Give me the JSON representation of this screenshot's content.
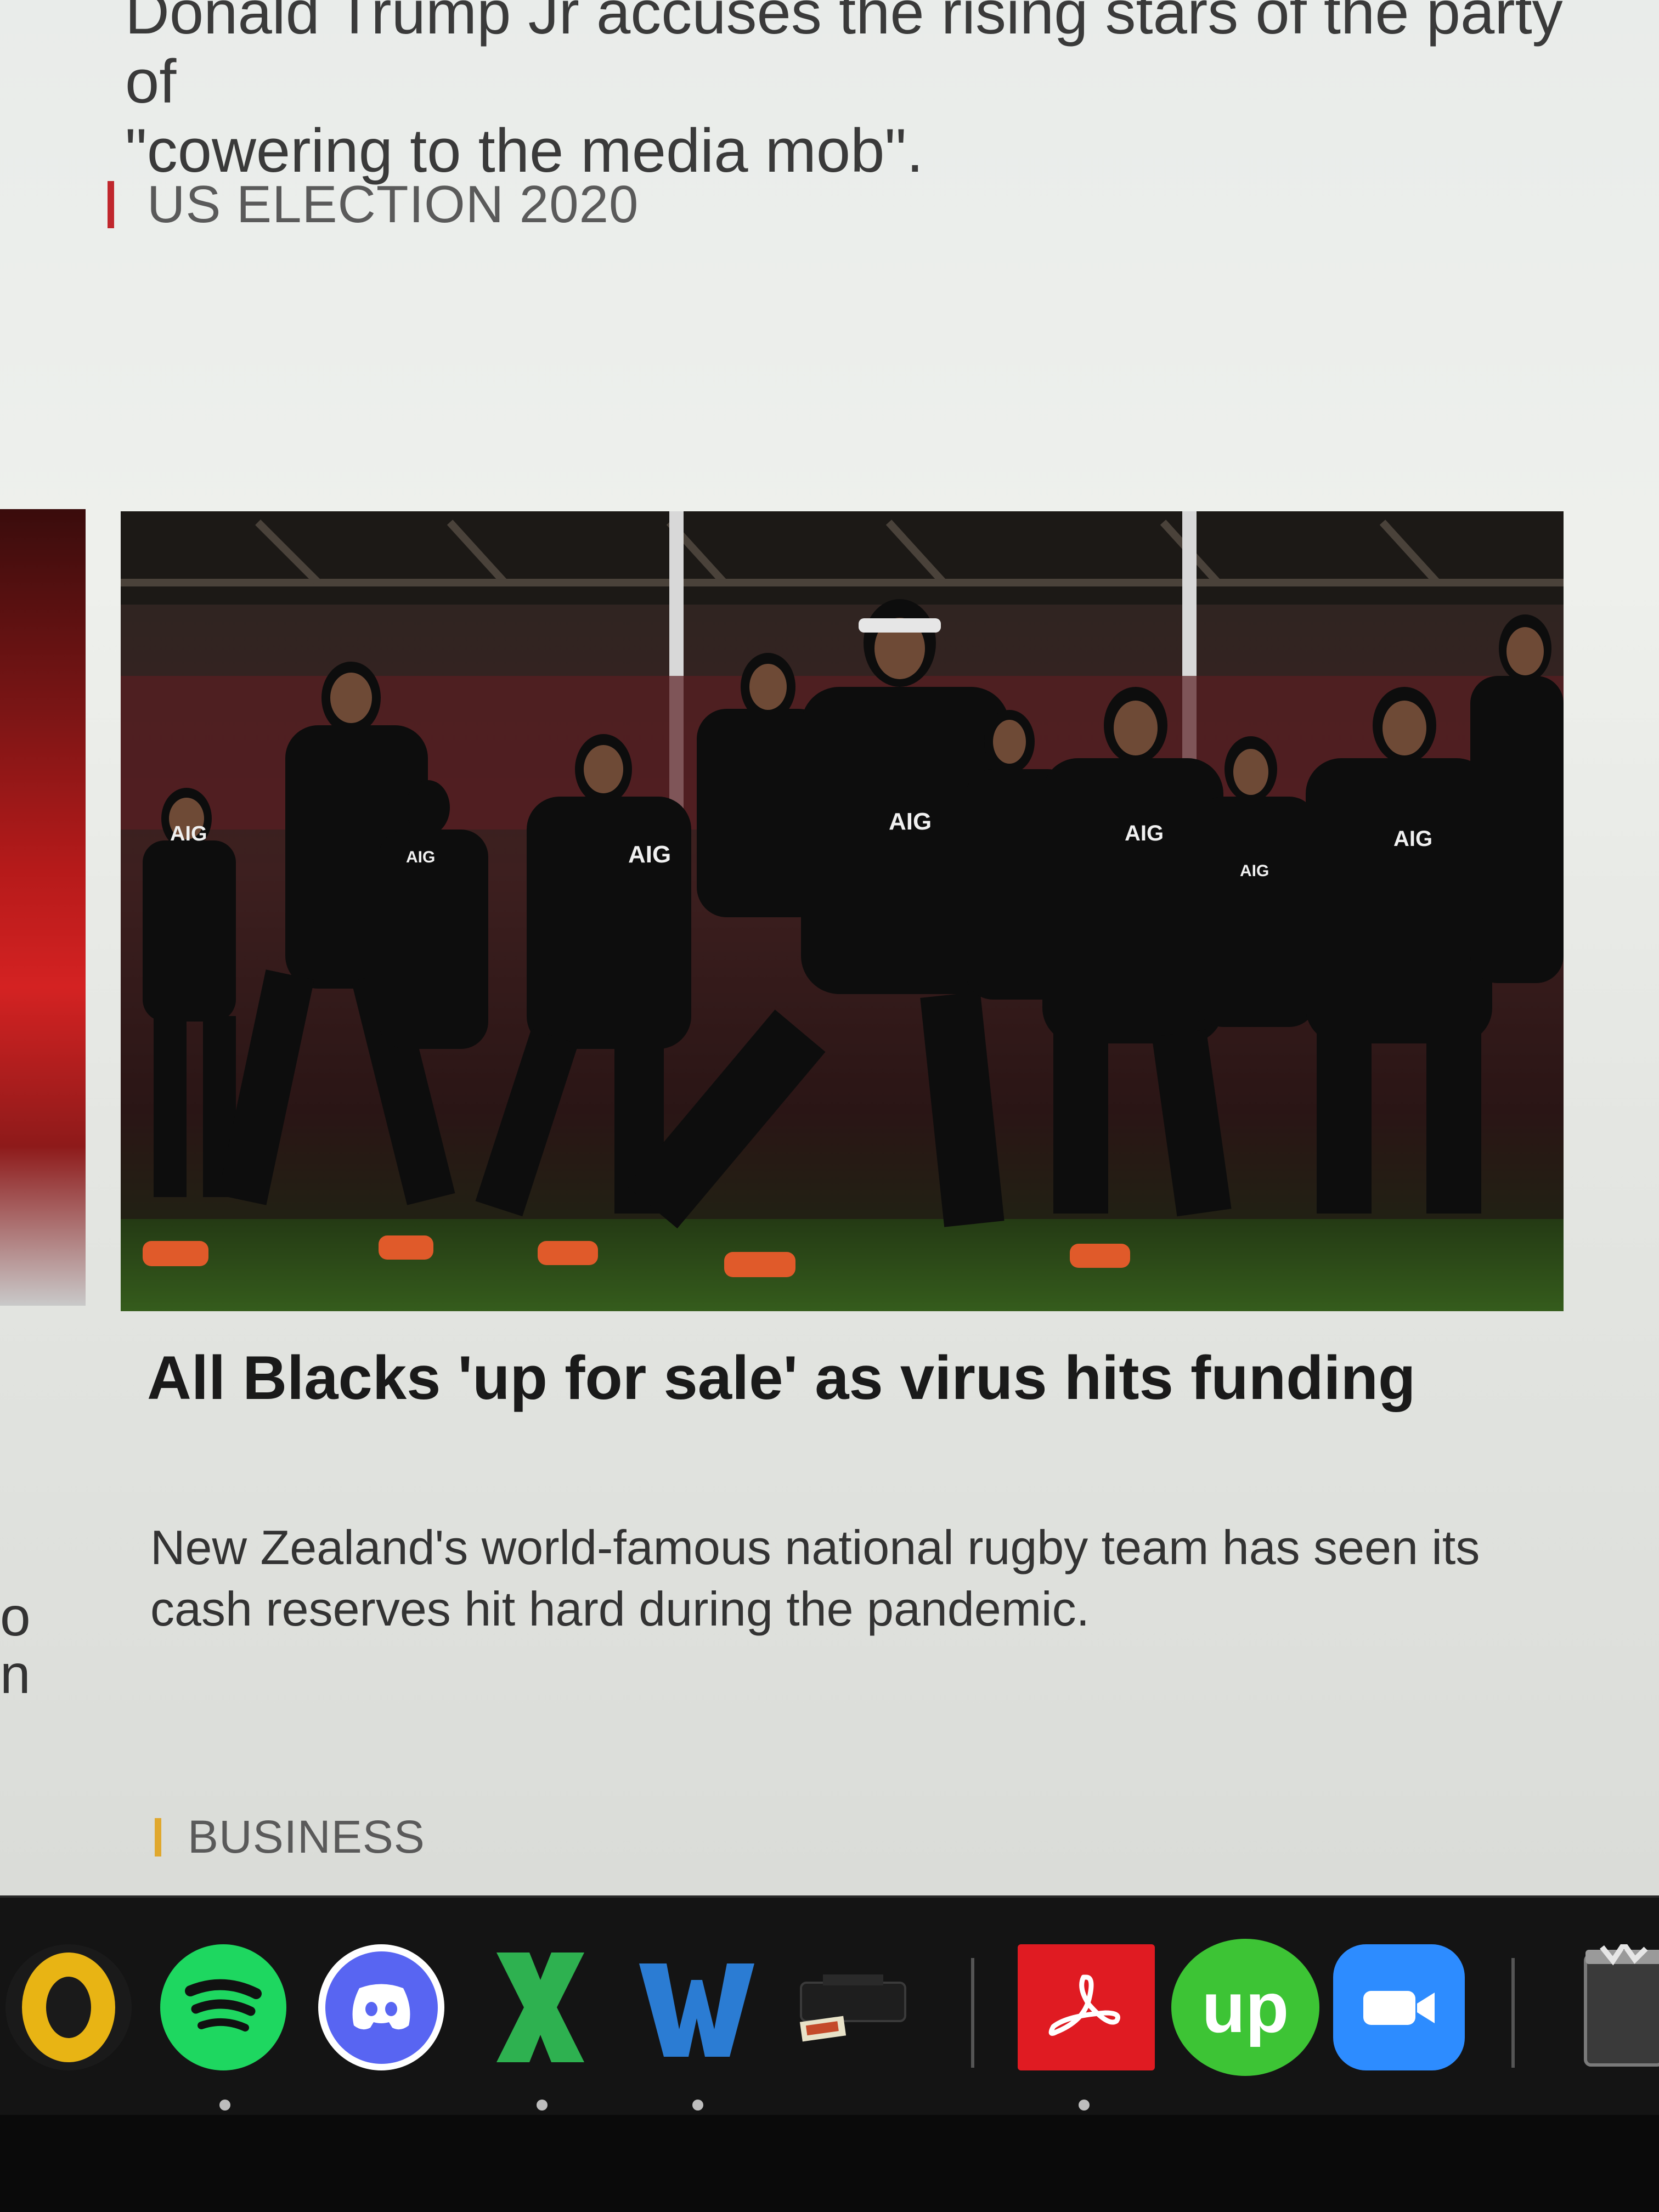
{
  "previous_article": {
    "summary_line_1": "Donald Trump Jr accuses the rising stars of the party of",
    "summary_line_2": "\"cowering to the media mob\".",
    "section": "US ELECTION 2020",
    "section_color": "#c0272d"
  },
  "left_card": {
    "fragment_line_1": "o",
    "fragment_line_2": "n"
  },
  "article": {
    "image_alt": "All Blacks rugby team performing the haka",
    "jersey_sponsor": "AIG",
    "headline": "All Blacks 'up for sale' as virus hits funding",
    "summary": "New Zealand's world-famous national rugby team has seen its cash reserves hit hard during the pandemic.",
    "section": "BUSINESS",
    "section_color": "#e0a82e"
  },
  "dock": {
    "apps": [
      {
        "name": "Microsoft Outlook",
        "icon": "outlook-icon",
        "glyph": "O",
        "color": "#e8b414",
        "running": false
      },
      {
        "name": "Spotify",
        "icon": "spotify-icon",
        "glyph": "",
        "color": "#1ed760",
        "running": true
      },
      {
        "name": "Discord",
        "icon": "discord-icon",
        "glyph": "",
        "color": "#5865f2",
        "running": false
      },
      {
        "name": "Microsoft Excel",
        "icon": "excel-icon",
        "glyph": "X",
        "color": "#2eb150",
        "running": true
      },
      {
        "name": "Microsoft Word",
        "icon": "word-icon",
        "glyph": "W",
        "color": "#2b7cd3",
        "running": true
      },
      {
        "name": "Printer",
        "icon": "printer-icon",
        "glyph": "",
        "color": "#1a1a1a",
        "running": false
      },
      {
        "name": "Adobe Acrobat",
        "icon": "acrobat-icon",
        "glyph": "",
        "color": "#e01b22",
        "running": true
      },
      {
        "name": "Upwork",
        "icon": "upwork-icon",
        "glyph": "up",
        "color": "#3dc435",
        "running": false
      },
      {
        "name": "Zoom",
        "icon": "zoom-icon",
        "glyph": "",
        "color": "#2d8cff",
        "running": false
      },
      {
        "name": "Trash",
        "icon": "trash-icon",
        "glyph": "",
        "color": "#8a8a8a",
        "running": false
      }
    ]
  }
}
